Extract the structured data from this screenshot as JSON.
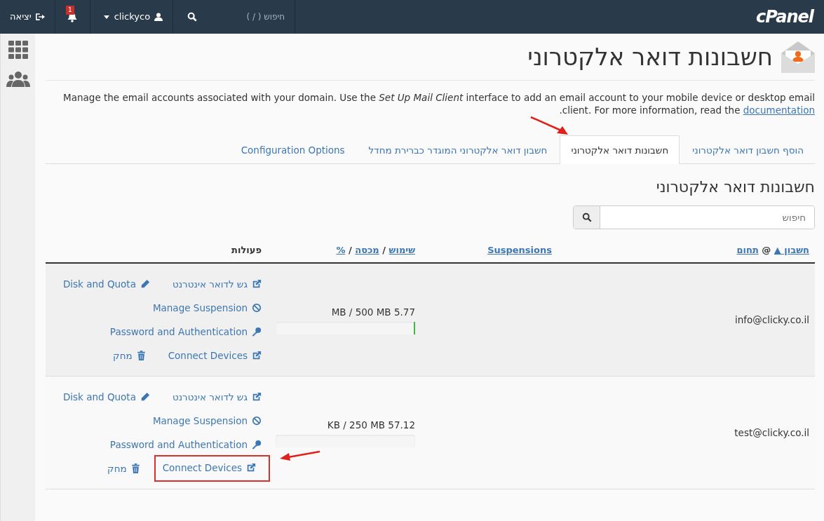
{
  "topbar": {
    "logo": "cPanel",
    "search": {
      "placeholder": "חיפוש ( / )"
    },
    "user": "clickyco",
    "notifications": "1",
    "logout": "יציאה"
  },
  "page": {
    "title": "חשבונות דואר אלקטרוני",
    "description": "Manage the email accounts associated with your domain. Use the *Set Up Mail Client* interface to add an email account to your mobile device or desktop email client. For more information, read the",
    "doc_link": "documentation",
    "description_end": "."
  },
  "tabs": [
    {
      "label": "הוסף חשבון דואר אלקטרוני",
      "selected": false
    },
    {
      "label": "חשבונות דואר אלקטרוני",
      "selected": true
    },
    {
      "label": "חשבון דואר אלקטרוני המוגדר כברירת מחדל",
      "selected": false
    },
    {
      "label": "Configuration Options",
      "selected": false
    }
  ],
  "section": {
    "title": "חשבונות דואר אלקטרוני",
    "search": {
      "placeholder": "חיפוש"
    }
  },
  "table": {
    "columns": [
      {
        "parts": [
          {
            "kind": "link",
            "text": "חשבון ▲"
          },
          {
            "kind": "text",
            "text": "@"
          },
          {
            "kind": "link",
            "text": "תחום"
          }
        ]
      },
      {
        "parts": [
          {
            "kind": "link",
            "text": "Suspensions"
          }
        ]
      },
      {
        "parts": [
          {
            "kind": "link",
            "text": "שימוש"
          },
          {
            "kind": "text",
            "text": "/"
          },
          {
            "kind": "link",
            "text": "מכסה"
          },
          {
            "kind": "text",
            "text": "/"
          },
          {
            "kind": "link",
            "text": "%"
          }
        ]
      },
      {
        "parts": [
          {
            "kind": "text",
            "text": "פעולות"
          }
        ]
      }
    ],
    "rows": [
      {
        "account": "info@clicky.co.il",
        "usage": "5.77 MB / 500 MB",
        "level": 0.012,
        "action_rows": [
          [
            {
              "kind": "external",
              "label": "גש לדואר אינטרנט",
              "highlighted": false
            },
            {
              "kind": "pencil",
              "label": "Disk and Quota",
              "highlighted": false
            }
          ],
          [
            {
              "kind": "ban",
              "label": "Manage Suspension",
              "highlighted": false
            }
          ],
          [
            {
              "kind": "key",
              "label": "Password and Authentication",
              "highlighted": false
            }
          ],
          [
            {
              "kind": "external",
              "label": "Connect Devices",
              "highlighted": false
            },
            {
              "kind": "trash",
              "label": "מחק",
              "highlighted": false
            }
          ]
        ]
      },
      {
        "account": "test@clicky.co.il",
        "usage": "57.12 KB / 250 MB",
        "level": 0.0002,
        "action_rows": [
          [
            {
              "kind": "external",
              "label": "גש לדואר אינטרנט",
              "highlighted": false
            },
            {
              "kind": "pencil",
              "label": "Disk and Quota",
              "highlighted": false
            }
          ],
          [
            {
              "kind": "ban",
              "label": "Manage Suspension",
              "highlighted": false
            }
          ],
          [
            {
              "kind": "key",
              "label": "Password and Authentication",
              "highlighted": false
            }
          ],
          [
            {
              "kind": "external",
              "label": "Connect Devices",
              "highlighted": true
            },
            {
              "kind": "trash",
              "label": "מחק",
              "highlighted": false
            }
          ]
        ]
      }
    ]
  }
}
